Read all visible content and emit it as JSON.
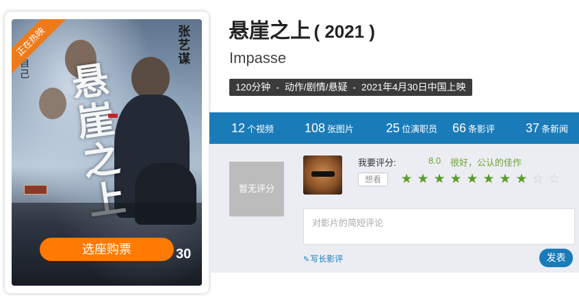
{
  "poster": {
    "badge": "正在热映",
    "buy_button_label": "选座购票",
    "art_title": "悬崖之上",
    "art_director": "张艺谋",
    "art_side_text": "绝自己",
    "art_number": "30"
  },
  "movie": {
    "title": "悬崖之上",
    "year": "( 2021 )",
    "english_title": "Impasse",
    "duration": "120分钟",
    "genres": "动作/剧情/悬疑",
    "release": "2021年4月30日中国上映",
    "separator": "-"
  },
  "stats": [
    {
      "count": "12",
      "unit": "个视频"
    },
    {
      "count": "108",
      "unit": "张图片"
    },
    {
      "count": "25",
      "unit": "位演职员"
    },
    {
      "count": "66",
      "unit": "条影评"
    },
    {
      "count": "37",
      "unit": "条新闻"
    }
  ],
  "rating": {
    "no_score_text": "暂无评分",
    "label": "我要评分:",
    "score": "8.0",
    "description": "很好，公认的佳作",
    "want_label": "想看",
    "stars_total": 10,
    "stars_filled": 8,
    "comment_placeholder": "对影片的简短评论",
    "write_review_label": "写长影评",
    "submit_label": "发表"
  },
  "colors": {
    "accent_blue": "#1a7bb9",
    "orange": "#ff7a00",
    "star_green": "#5b9a2a",
    "score_green": "#6aa333"
  }
}
